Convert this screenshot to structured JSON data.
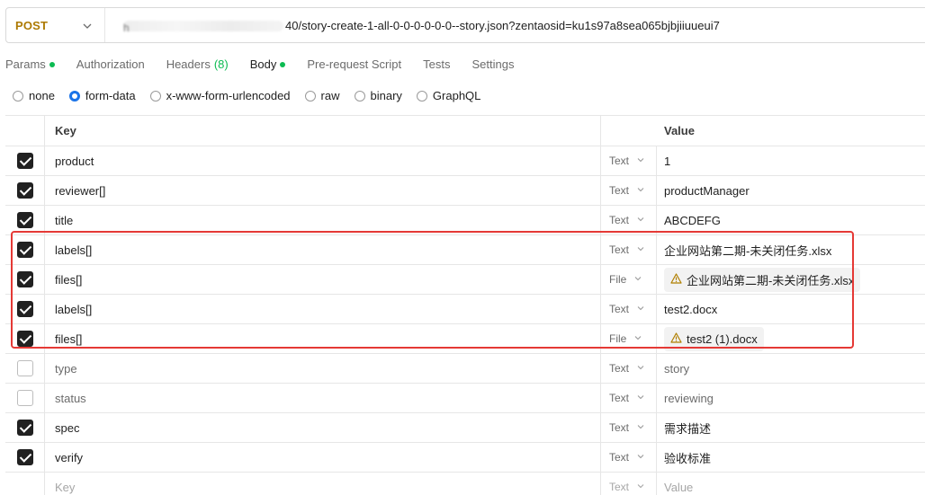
{
  "request": {
    "method": "POST",
    "url_visible": "40/story-create-1-all-0-0-0-0-0-0--story.json?zentaosid=ku1s97a8sea065bjbjiiuueui7",
    "url_host_fragment": "h"
  },
  "tabs": [
    {
      "label": "Params",
      "dot": true,
      "active": false
    },
    {
      "label": "Authorization",
      "dot": false,
      "active": false
    },
    {
      "label": "Headers",
      "count": "(8)",
      "active": false
    },
    {
      "label": "Body",
      "dot": true,
      "active": true
    },
    {
      "label": "Pre-request Script",
      "active": false
    },
    {
      "label": "Tests",
      "active": false
    },
    {
      "label": "Settings",
      "active": false
    }
  ],
  "body_types": [
    {
      "label": "none",
      "selected": false
    },
    {
      "label": "form-data",
      "selected": true
    },
    {
      "label": "x-www-form-urlencoded",
      "selected": false
    },
    {
      "label": "raw",
      "selected": false
    },
    {
      "label": "binary",
      "selected": false
    },
    {
      "label": "GraphQL",
      "selected": false
    }
  ],
  "table": {
    "headers": {
      "key": "Key",
      "value": "Value"
    },
    "rows": [
      {
        "checked": true,
        "key": "product",
        "type": "Text",
        "value": "1"
      },
      {
        "checked": true,
        "key": "reviewer[]",
        "type": "Text",
        "value": "productManager"
      },
      {
        "checked": true,
        "key": "title",
        "type": "Text",
        "value": "ABCDEFG"
      },
      {
        "checked": true,
        "key": "labels[]",
        "type": "Text",
        "value": "企业网站第二期-未关闭任务.xlsx"
      },
      {
        "checked": true,
        "key": "files[]",
        "type": "File",
        "value": "企业网站第二期-未关闭任务.xlsx",
        "file": true
      },
      {
        "checked": true,
        "key": "labels[]",
        "type": "Text",
        "value": "test2.docx"
      },
      {
        "checked": true,
        "key": "files[]",
        "type": "File",
        "value": "test2 (1).docx",
        "file": true
      },
      {
        "checked": false,
        "key": "type",
        "type": "Text",
        "value": "story"
      },
      {
        "checked": false,
        "key": "status",
        "type": "Text",
        "value": "reviewing"
      },
      {
        "checked": true,
        "key": "spec",
        "type": "Text",
        "value": "需求描述"
      },
      {
        "checked": true,
        "key": "verify",
        "type": "Text",
        "value": "验收标准"
      }
    ],
    "placeholder": {
      "key": "Key",
      "type": "Text",
      "value": "Value"
    }
  },
  "colors": {
    "method": "#ad7a03",
    "active_dot": "#0cbb52",
    "radio_selected": "#1a73e8",
    "highlight": "#e53935",
    "warning_icon": "#b07f00"
  }
}
